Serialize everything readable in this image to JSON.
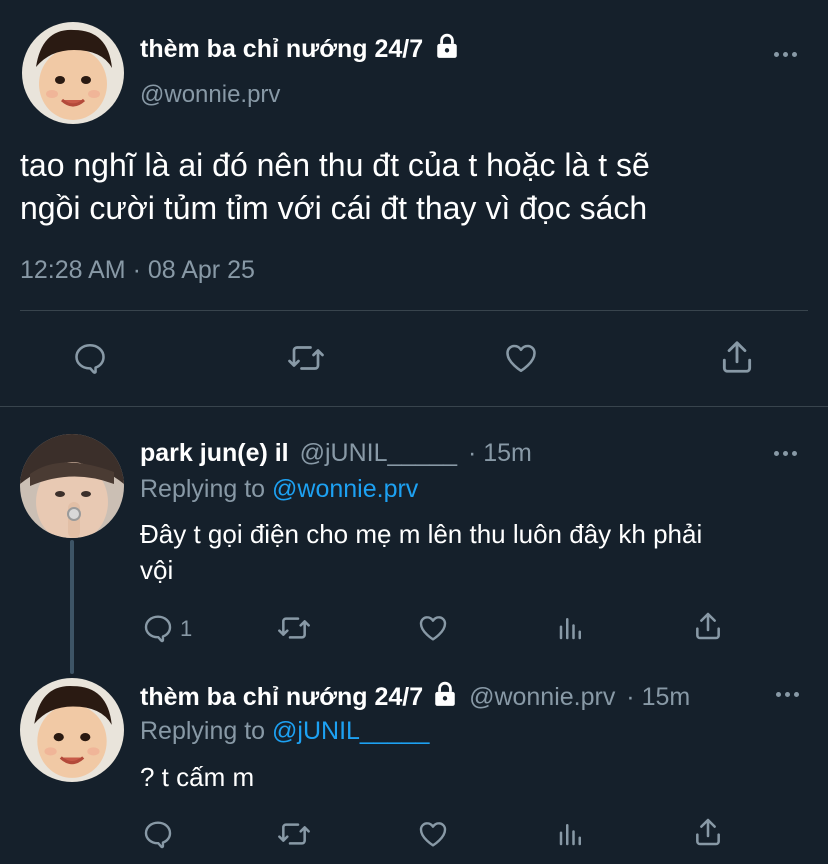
{
  "main_tweet": {
    "display_name": "thèm ba chỉ nướng 24/7",
    "handle": "@wonnie.prv",
    "text_line1": "tao nghĩ là ai đó nên thu đt của t hoặc là t sẽ",
    "text_line2": "ngồi cười tủm tỉm với cái đt thay vì đọc sách",
    "timestamp": "12:28 AM · 08 Apr 25",
    "protected": true
  },
  "replies": [
    {
      "display_name": "park jun(e) il",
      "handle": "@jUNIL_____",
      "time": "· 15m",
      "replying_label": "Replying to",
      "replying_to": "@wonnie.prv",
      "text_line1": "Đây t gọi điện cho mẹ m lên thu luôn đây kh phải",
      "text_line2": "vội",
      "reply_count": "1",
      "protected": false
    },
    {
      "display_name": "thèm ba chỉ nướng 24/7",
      "handle": "@wonnie.prv",
      "time": "· 15m",
      "replying_label": "Replying to",
      "replying_to": "@jUNIL_____",
      "text_line1": "? t cấm m",
      "reply_count": "",
      "protected": true
    }
  ],
  "icons": {
    "reply": "reply-icon",
    "retweet": "retweet-icon",
    "like": "heart-icon",
    "share": "share-icon",
    "analytics": "analytics-icon",
    "more": "more-icon",
    "lock": "lock-icon"
  },
  "colors": {
    "background": "#15202b",
    "text": "#ffffff",
    "muted": "#8899a6",
    "link": "#1da1f2",
    "divider": "#38444d"
  }
}
